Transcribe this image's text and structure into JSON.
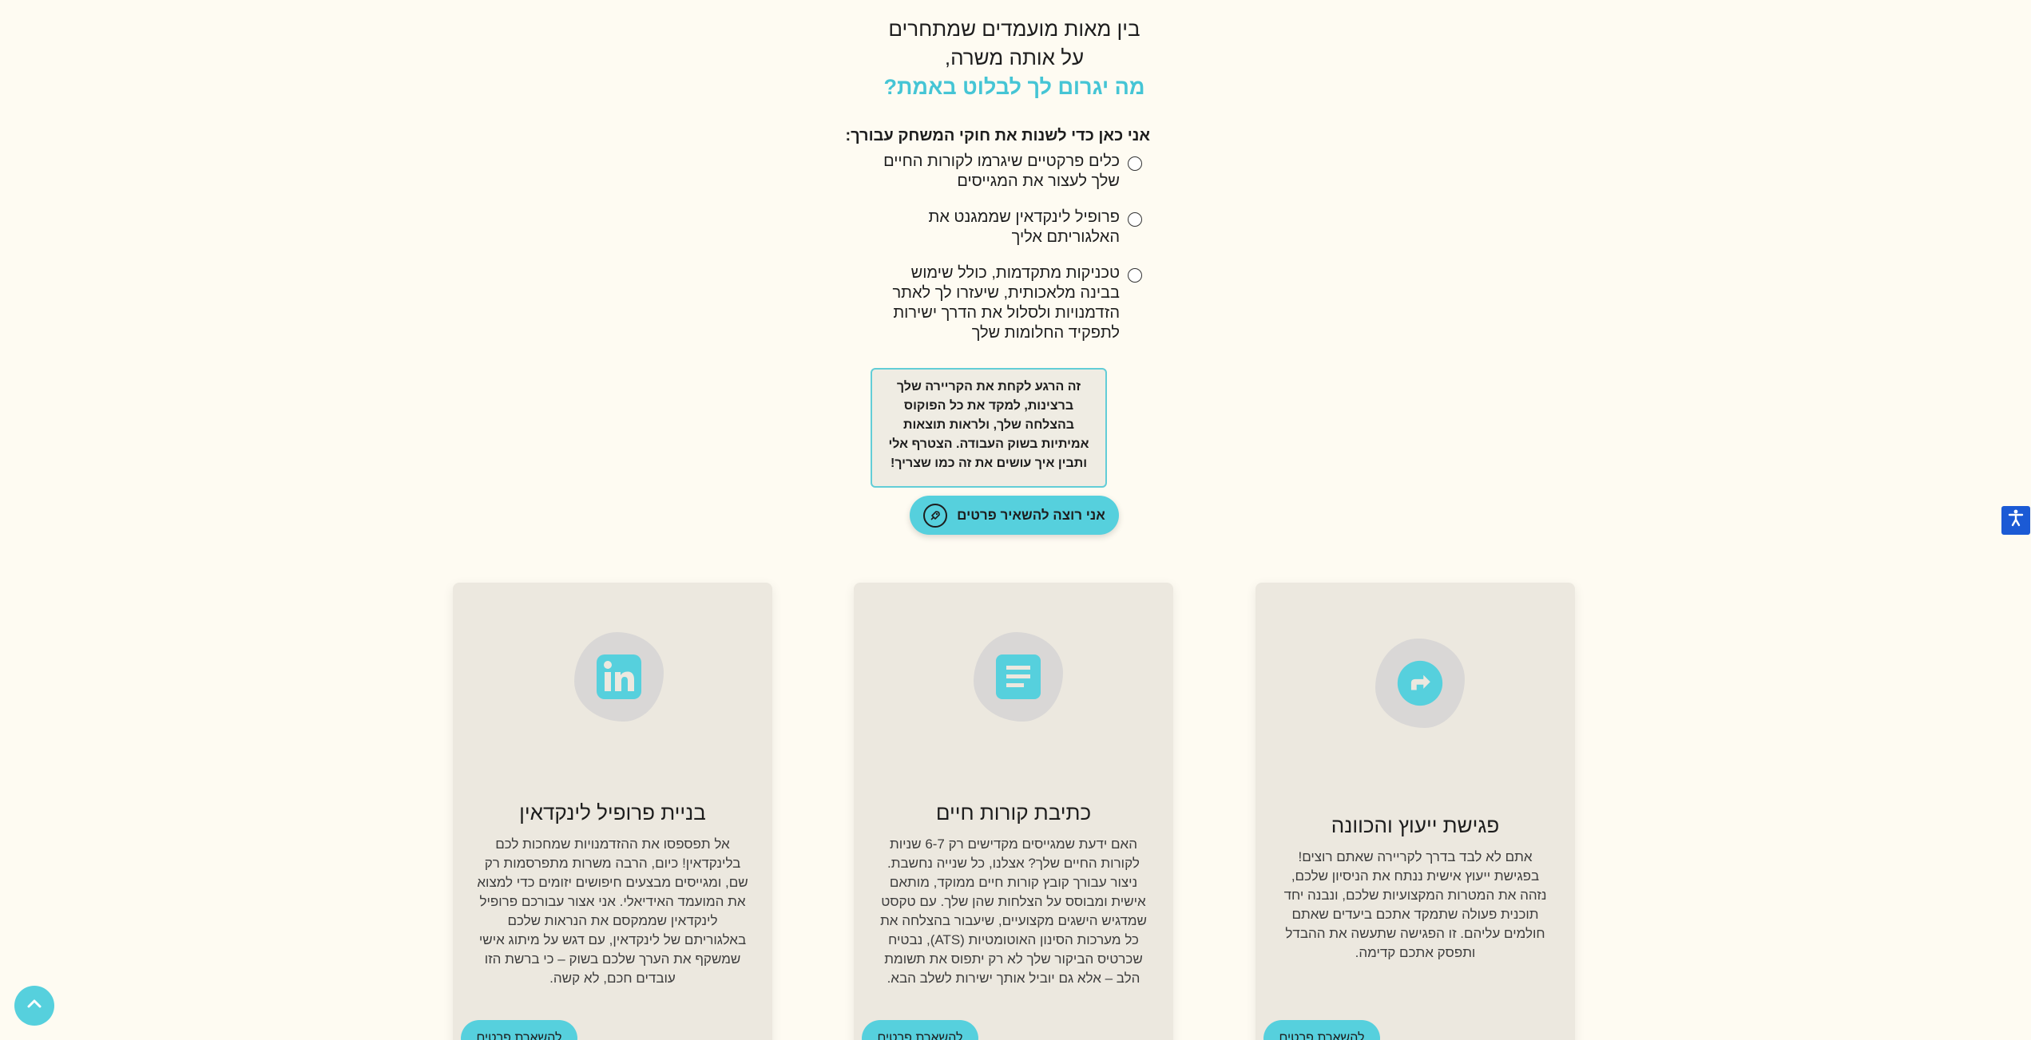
{
  "hero": {
    "line1": "בין מאות מועמדים שמתחרים",
    "line2": "על אותה משרה,",
    "line3": "מה יגרום לך לבלוט באמת?"
  },
  "intro": "אני כאן כדי לשנות את חוקי המשחק עבורך:",
  "options": [
    "כלים פרקטיים שיגרמו לקורות החיים שלך לעצור את המגייסים",
    "פרופיל לינקדאין שממגנט את האלגוריתם אליך",
    "טכניקות מתקדמות, כולל שימוש בבינה מלאכותית, שיעזרו לך לאתר הזדמנויות ולסלול את הדרך ישירות לתפקיד החלומות שלך"
  ],
  "callout": "זה הרגע לקחת את הקריירה שלך ברצינות, למקד את כל הפוקוס בהצלחה שלך, ולראות תוצאות אמיתיות בשוק העבודה. הצטרף אלי ותבין איך עושים את זה כמו שצריך!",
  "cta": {
    "label": "אני רוצה להשאיר פרטים",
    "icon": "rocket-icon"
  },
  "cards": [
    {
      "icon": "linkedin-icon",
      "title": "בניית פרופיל לינקדאין",
      "body": "אל תפספסו את ההזדמנויות שמחכות לכם בלינקדאין! כיום, הרבה משרות מתפרסמות רק שם, ומגייסים מבצעים חיפושים יזומים כדי למצוא את המועמד האידיאלי. אני אצור עבורכם פרופיל לינקדאין שממקסם את הנראות שלכם באלגוריתם של לינקדאין, עם דגש על מיתוג אישי שמשקף את הערך שלכם בשוק – כי ברשת הזו עובדים חכם, לא קשה.",
      "button": "להשארת פרטים"
    },
    {
      "icon": "document-icon",
      "title": "כתיבת קורות חיים",
      "body": "האם ידעת שמגייסים מקדישים רק 6-7 שניות לקורות החיים שלך? אצלנו, כל שנייה נחשבת. ניצור עבורך קובץ קורות חיים ממוקד, מותאם אישית ומבוסס על הצלחות שהן שלך. עם טקסט שמדגיש הישגים מקצועיים, שיעבור בהצלחה את כל מערכות הסינון האוטומטיות (ATS), נבטיח שכרטיס הביקור שלך לא רק יתפוס את תשומת הלב – אלא גם יוביל אותך ישירות לשלב הבא.",
      "button": "להשארת פרטים"
    },
    {
      "icon": "direction-sign-icon",
      "title": "פגישת ייעוץ והכוונה",
      "body": "אתם לא לבד בדרך לקריירה שאתם רוצים! בפגישת ייעוץ אישית ננתח את הניסיון שלכם, נזהה את המטרות המקצועיות שלכם, ונבנה יחד תוכנית פעולה שתמקד אתכם ביעדים שאתם חולמים עליהם. זו הפגישה שתעשה את ההבדל ותפסק אתכם קדימה.",
      "button": "להשארת פרטים"
    }
  ],
  "colors": {
    "background": "#fefbf2",
    "accent": "#56d0dd",
    "accent_text": "#45c5d5",
    "card_bg": "#ece8df",
    "a11y_blue": "#1b5ad5"
  },
  "widgets": {
    "accessibility_icon": "accessibility-icon",
    "back_to_top_icon": "chevron-up-icon"
  }
}
